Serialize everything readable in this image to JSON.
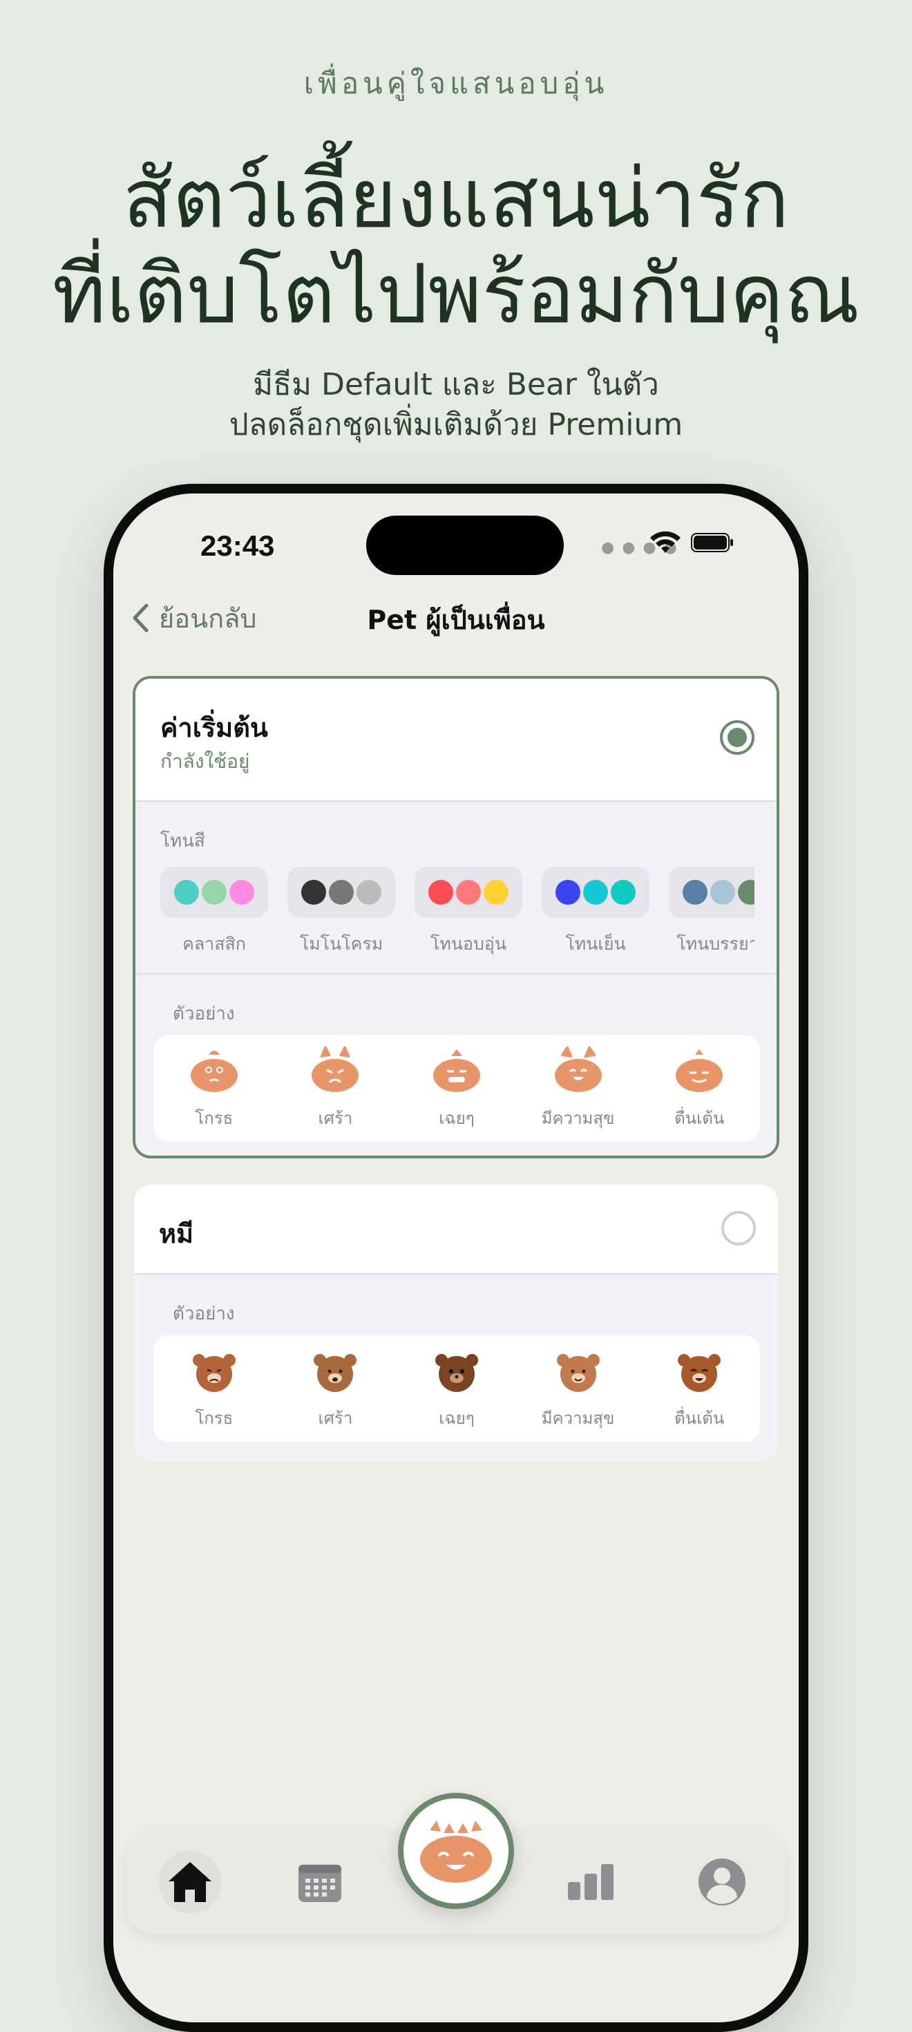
{
  "marketing": {
    "kicker": "เพื่อนคู่ใจแสนอบอุ่น",
    "headline_line1": "สัตว์เลี้ยงแสนน่ารัก",
    "headline_line2": "ที่เติบโตไปพร้อมกับคุณ",
    "sub_line1": "มีธีม Default และ Bear ในตัว",
    "sub_line2": "ปลดล็อกชุดเพิ่มเติมด้วย Premium"
  },
  "status_bar": {
    "time": "23:43"
  },
  "nav": {
    "back_label": "ย้อนกลับ",
    "title": "Pet ผู้เป็นเพื่อน"
  },
  "themes": [
    {
      "title": "ค่าเริ่มต้น",
      "status": "กำลังใช้อยู่",
      "selected": true,
      "tone_label": "โทนสี",
      "tones": [
        {
          "label": "คลาสสิก",
          "colors": [
            "#4ecdc4",
            "#95d5a8",
            "#ff8ae0"
          ]
        },
        {
          "label": "โมโนโครม",
          "colors": [
            "#333333",
            "#777777",
            "#bbbbbb"
          ]
        },
        {
          "label": "โทนอบอุ่น",
          "colors": [
            "#ff4b55",
            "#ff7b7b",
            "#ffd233"
          ]
        },
        {
          "label": "โทนเย็น",
          "colors": [
            "#3a44f0",
            "#14c8d4",
            "#12c9be"
          ]
        },
        {
          "label": "โทนบรรยาก",
          "colors": [
            "#5a7fa6",
            "#a9c4d6",
            "#6b8a6b"
          ]
        }
      ],
      "preview_label": "ตัวอย่าง",
      "moods": [
        "โกรธ",
        "เศร้า",
        "เฉยๆ",
        "มีความสุข",
        "ตื่นเต้น"
      ]
    },
    {
      "title": "หมี",
      "selected": false,
      "preview_label": "ตัวอย่าง",
      "moods": [
        "โกรธ",
        "เศร้า",
        "เฉยๆ",
        "มีความสุข",
        "ตื่นเต้น"
      ]
    }
  ],
  "colors": {
    "accent": "#6b8a6b",
    "pet_orange": "#e8956a",
    "bear_brown": "#b46a3a",
    "background": "#e4ebe2"
  },
  "tabbar": {
    "items": [
      "home-icon",
      "calendar-icon",
      "pet-center",
      "chart-icon",
      "profile-icon"
    ],
    "active": "home-icon"
  }
}
